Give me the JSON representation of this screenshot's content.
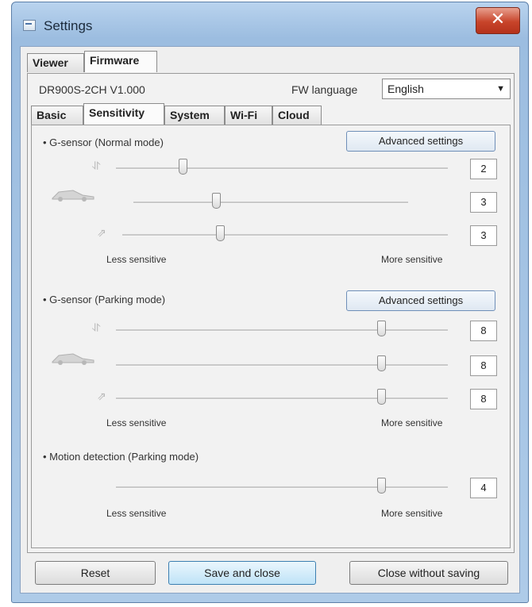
{
  "window": {
    "title": "Settings",
    "close_glyph": "✕"
  },
  "outer_tabs": [
    {
      "label": "Viewer"
    },
    {
      "label": "Firmware",
      "active": true
    }
  ],
  "firmware": {
    "model_version": "DR900S-2CH  V1.000",
    "fw_language_label": "FW language",
    "fw_language_value": "English"
  },
  "inner_tabs": [
    {
      "label": "Basic"
    },
    {
      "label": "Sensitivity",
      "active": true
    },
    {
      "label": "System"
    },
    {
      "label": "Wi-Fi"
    },
    {
      "label": "Cloud"
    }
  ],
  "sections": {
    "gsensor_normal": {
      "label": "• G-sensor (Normal mode)",
      "advanced_label": "Advanced settings",
      "sliders": [
        {
          "axis": "vertical",
          "value": "2",
          "level_fraction": 0.2
        },
        {
          "axis": "lateral",
          "value": "3",
          "level_fraction": 0.3
        },
        {
          "axis": "longitudinal",
          "value": "3",
          "level_fraction": 0.3
        }
      ],
      "less_label": "Less sensitive",
      "more_label": "More sensitive"
    },
    "gsensor_parking": {
      "label": "• G-sensor (Parking mode)",
      "advanced_label": "Advanced settings",
      "sliders": [
        {
          "axis": "vertical",
          "value": "8",
          "level_fraction": 0.8
        },
        {
          "axis": "lateral",
          "value": "8",
          "level_fraction": 0.8
        },
        {
          "axis": "longitudinal",
          "value": "8",
          "level_fraction": 0.8
        }
      ],
      "less_label": "Less sensitive",
      "more_label": "More sensitive"
    },
    "motion_parking": {
      "label": "• Motion detection (Parking mode)",
      "sliders": [
        {
          "value": "4",
          "level_fraction": 0.8
        }
      ],
      "less_label": "Less sensitive",
      "more_label": "More sensitive"
    }
  },
  "buttons": {
    "reset": "Reset",
    "save_close": "Save and close",
    "close_nosave": "Close without saving"
  },
  "icons": {
    "vertical_axis": "up-down-arrow-icon",
    "lateral_axis": "car-side-icon",
    "longitudinal_axis": "forward-arrow-icon"
  }
}
